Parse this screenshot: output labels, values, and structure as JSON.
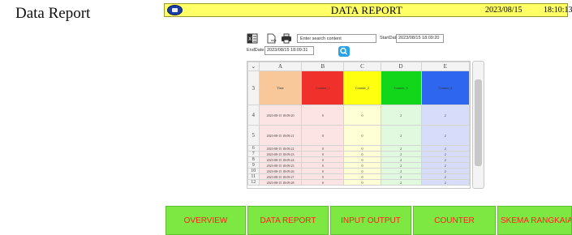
{
  "side_title": "Data Report",
  "header": {
    "title": "DATA REPORT",
    "date": "2023/08/15",
    "time": "18:10:13",
    "accent": "#ffff66"
  },
  "toolbar": {
    "icons": [
      "excel-export-icon",
      "file-export-icon",
      "print-icon"
    ],
    "search_placeholder": "Enter search content",
    "start_label": "StartDate",
    "start_value": "2023/08/15 18:09:20",
    "end_label": "EndDate",
    "end_value": "2023/08/15 18:09:31"
  },
  "grid": {
    "columns": [
      "A",
      "B",
      "C",
      "D",
      "E"
    ],
    "header_row_number": "3",
    "headers": [
      "Time",
      "Counter_1",
      "Counter_2",
      "Counter_3",
      "Counter_4"
    ],
    "rows": [
      {
        "n": "4",
        "time": "2023-08-15 18:09:20",
        "c1": "0",
        "c2": "0",
        "c3": "2",
        "c4": "2"
      },
      {
        "n": "5",
        "time": "2023-08-15 18:09:21",
        "c1": "0",
        "c2": "0",
        "c3": "2",
        "c4": "2"
      },
      {
        "n": "6",
        "time": "2023-08-15 18:09:22",
        "c1": "0",
        "c2": "0",
        "c3": "2",
        "c4": "2"
      },
      {
        "n": "7",
        "time": "2023-08-15 18:09:23",
        "c1": "0",
        "c2": "0",
        "c3": "2",
        "c4": "2"
      },
      {
        "n": "8",
        "time": "2023-08-15 18:09:24",
        "c1": "0",
        "c2": "0",
        "c3": "2",
        "c4": "2"
      },
      {
        "n": "9",
        "time": "2023-08-15 18:09:25",
        "c1": "0",
        "c2": "0",
        "c3": "2",
        "c4": "2"
      },
      {
        "n": "10",
        "time": "2023-08-15 18:09:26",
        "c1": "0",
        "c2": "0",
        "c3": "2",
        "c4": "2"
      },
      {
        "n": "11",
        "time": "2023-08-15 18:09:27",
        "c1": "0",
        "c2": "0",
        "c3": "2",
        "c4": "2"
      },
      {
        "n": "12",
        "time": "2023-08-15 18:09:28",
        "c1": "0",
        "c2": "0",
        "c3": "2",
        "c4": "2"
      }
    ],
    "header_colors": [
      "#f9c89a",
      "#f0302a",
      "#ffff10",
      "#12d61a",
      "#2e66f0"
    ]
  },
  "nav": [
    {
      "label": "OVERVIEW"
    },
    {
      "label": "DATA REPORT"
    },
    {
      "label": "INPUT OUTPUT"
    },
    {
      "label": "COUNTER"
    },
    {
      "label": "SKEMA RANGKAIAN"
    }
  ],
  "nav_colors": {
    "background": "#7ee842",
    "text": "#ff2020"
  }
}
